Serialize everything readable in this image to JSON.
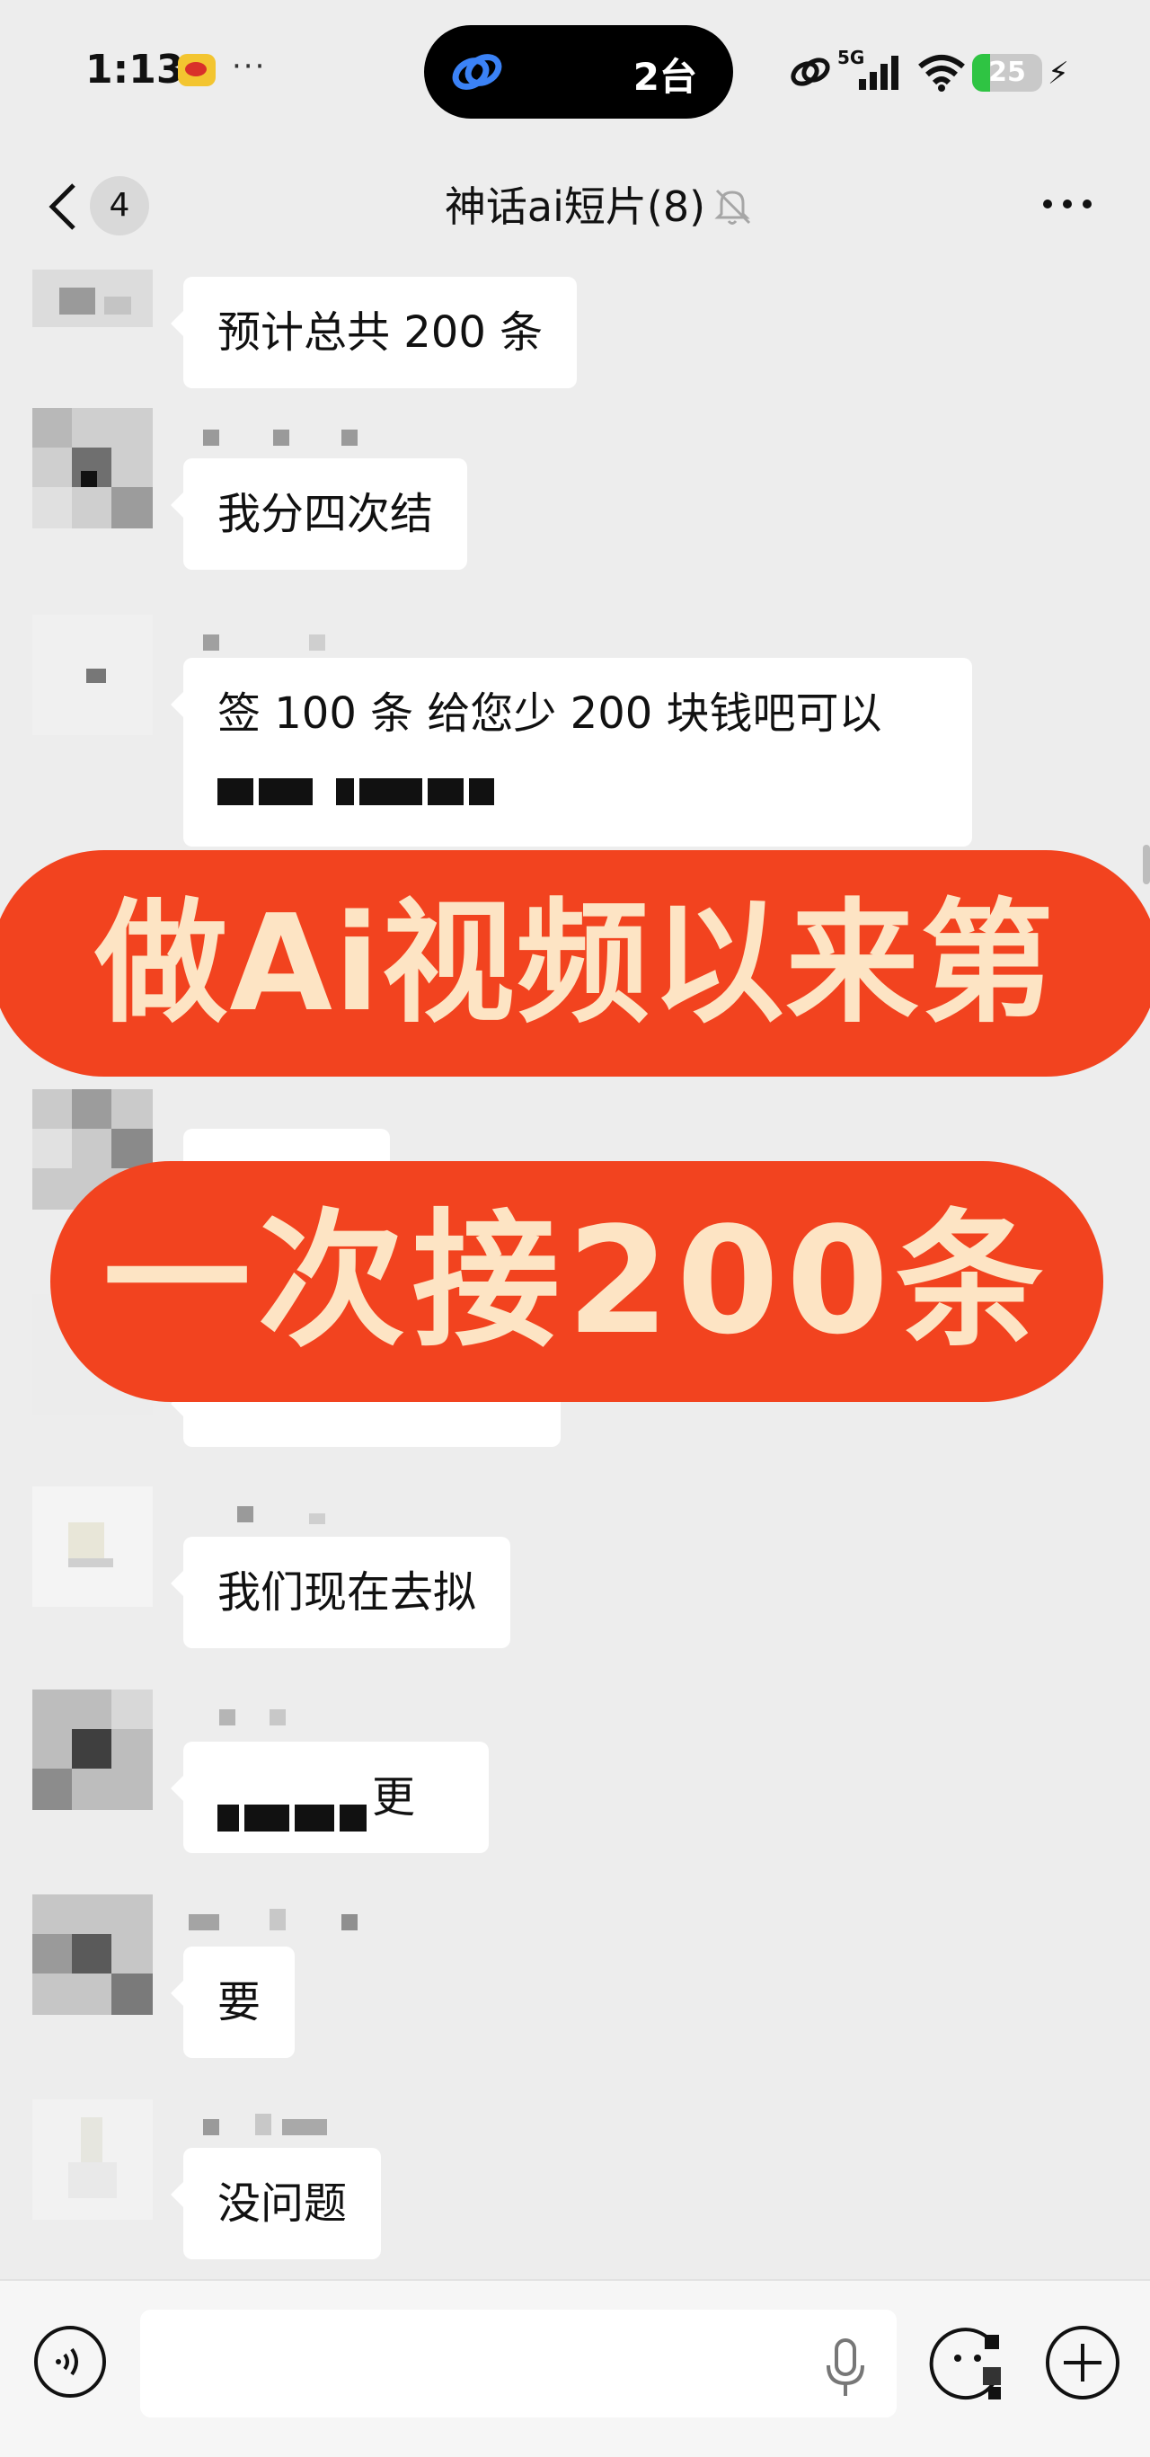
{
  "status_bar": {
    "time": "1:13",
    "dots": "···",
    "island_text": "2台",
    "network": "5G",
    "battery": "25",
    "battery_level": 0.25,
    "app_icon": "weibo-icon"
  },
  "nav": {
    "unread_count": "4",
    "title": "神话ai短片(8)",
    "icons": [
      "back-chevron-icon",
      "mute-bell-icon",
      "more-dots-icon"
    ]
  },
  "messages": [
    {
      "text": "预计总共 200 条",
      "nick_visible": false
    },
    {
      "text": "我分四次结",
      "nick_visible": true
    },
    {
      "text_line1": "签 100 条 给您少 200 块钱吧可以",
      "text_line2_redacted": true,
      "nick_visible": true
    },
    {
      "text": "",
      "partially_hidden": true
    },
    {
      "text": "",
      "partially_hidden": true
    },
    {
      "text": "我们现在去拟",
      "nick_visible": true
    },
    {
      "text_redacted_suffix": "更",
      "nick_visible": true
    },
    {
      "text": "要",
      "nick_visible": true
    },
    {
      "text": "没问题",
      "nick_visible": true
    }
  ],
  "overlay": {
    "line1": "做Ai视频以来第",
    "line2": "一次接200条",
    "color": "#f2431f",
    "text_color": "#fde4c4"
  },
  "input_bar": {
    "placeholder": "",
    "icons": [
      "voice-icon",
      "mic-icon",
      "emoji-icon",
      "plus-icon"
    ]
  },
  "colors": {
    "background": "#ededed",
    "bubble": "#ffffff",
    "accent_green": "#2fc443"
  }
}
